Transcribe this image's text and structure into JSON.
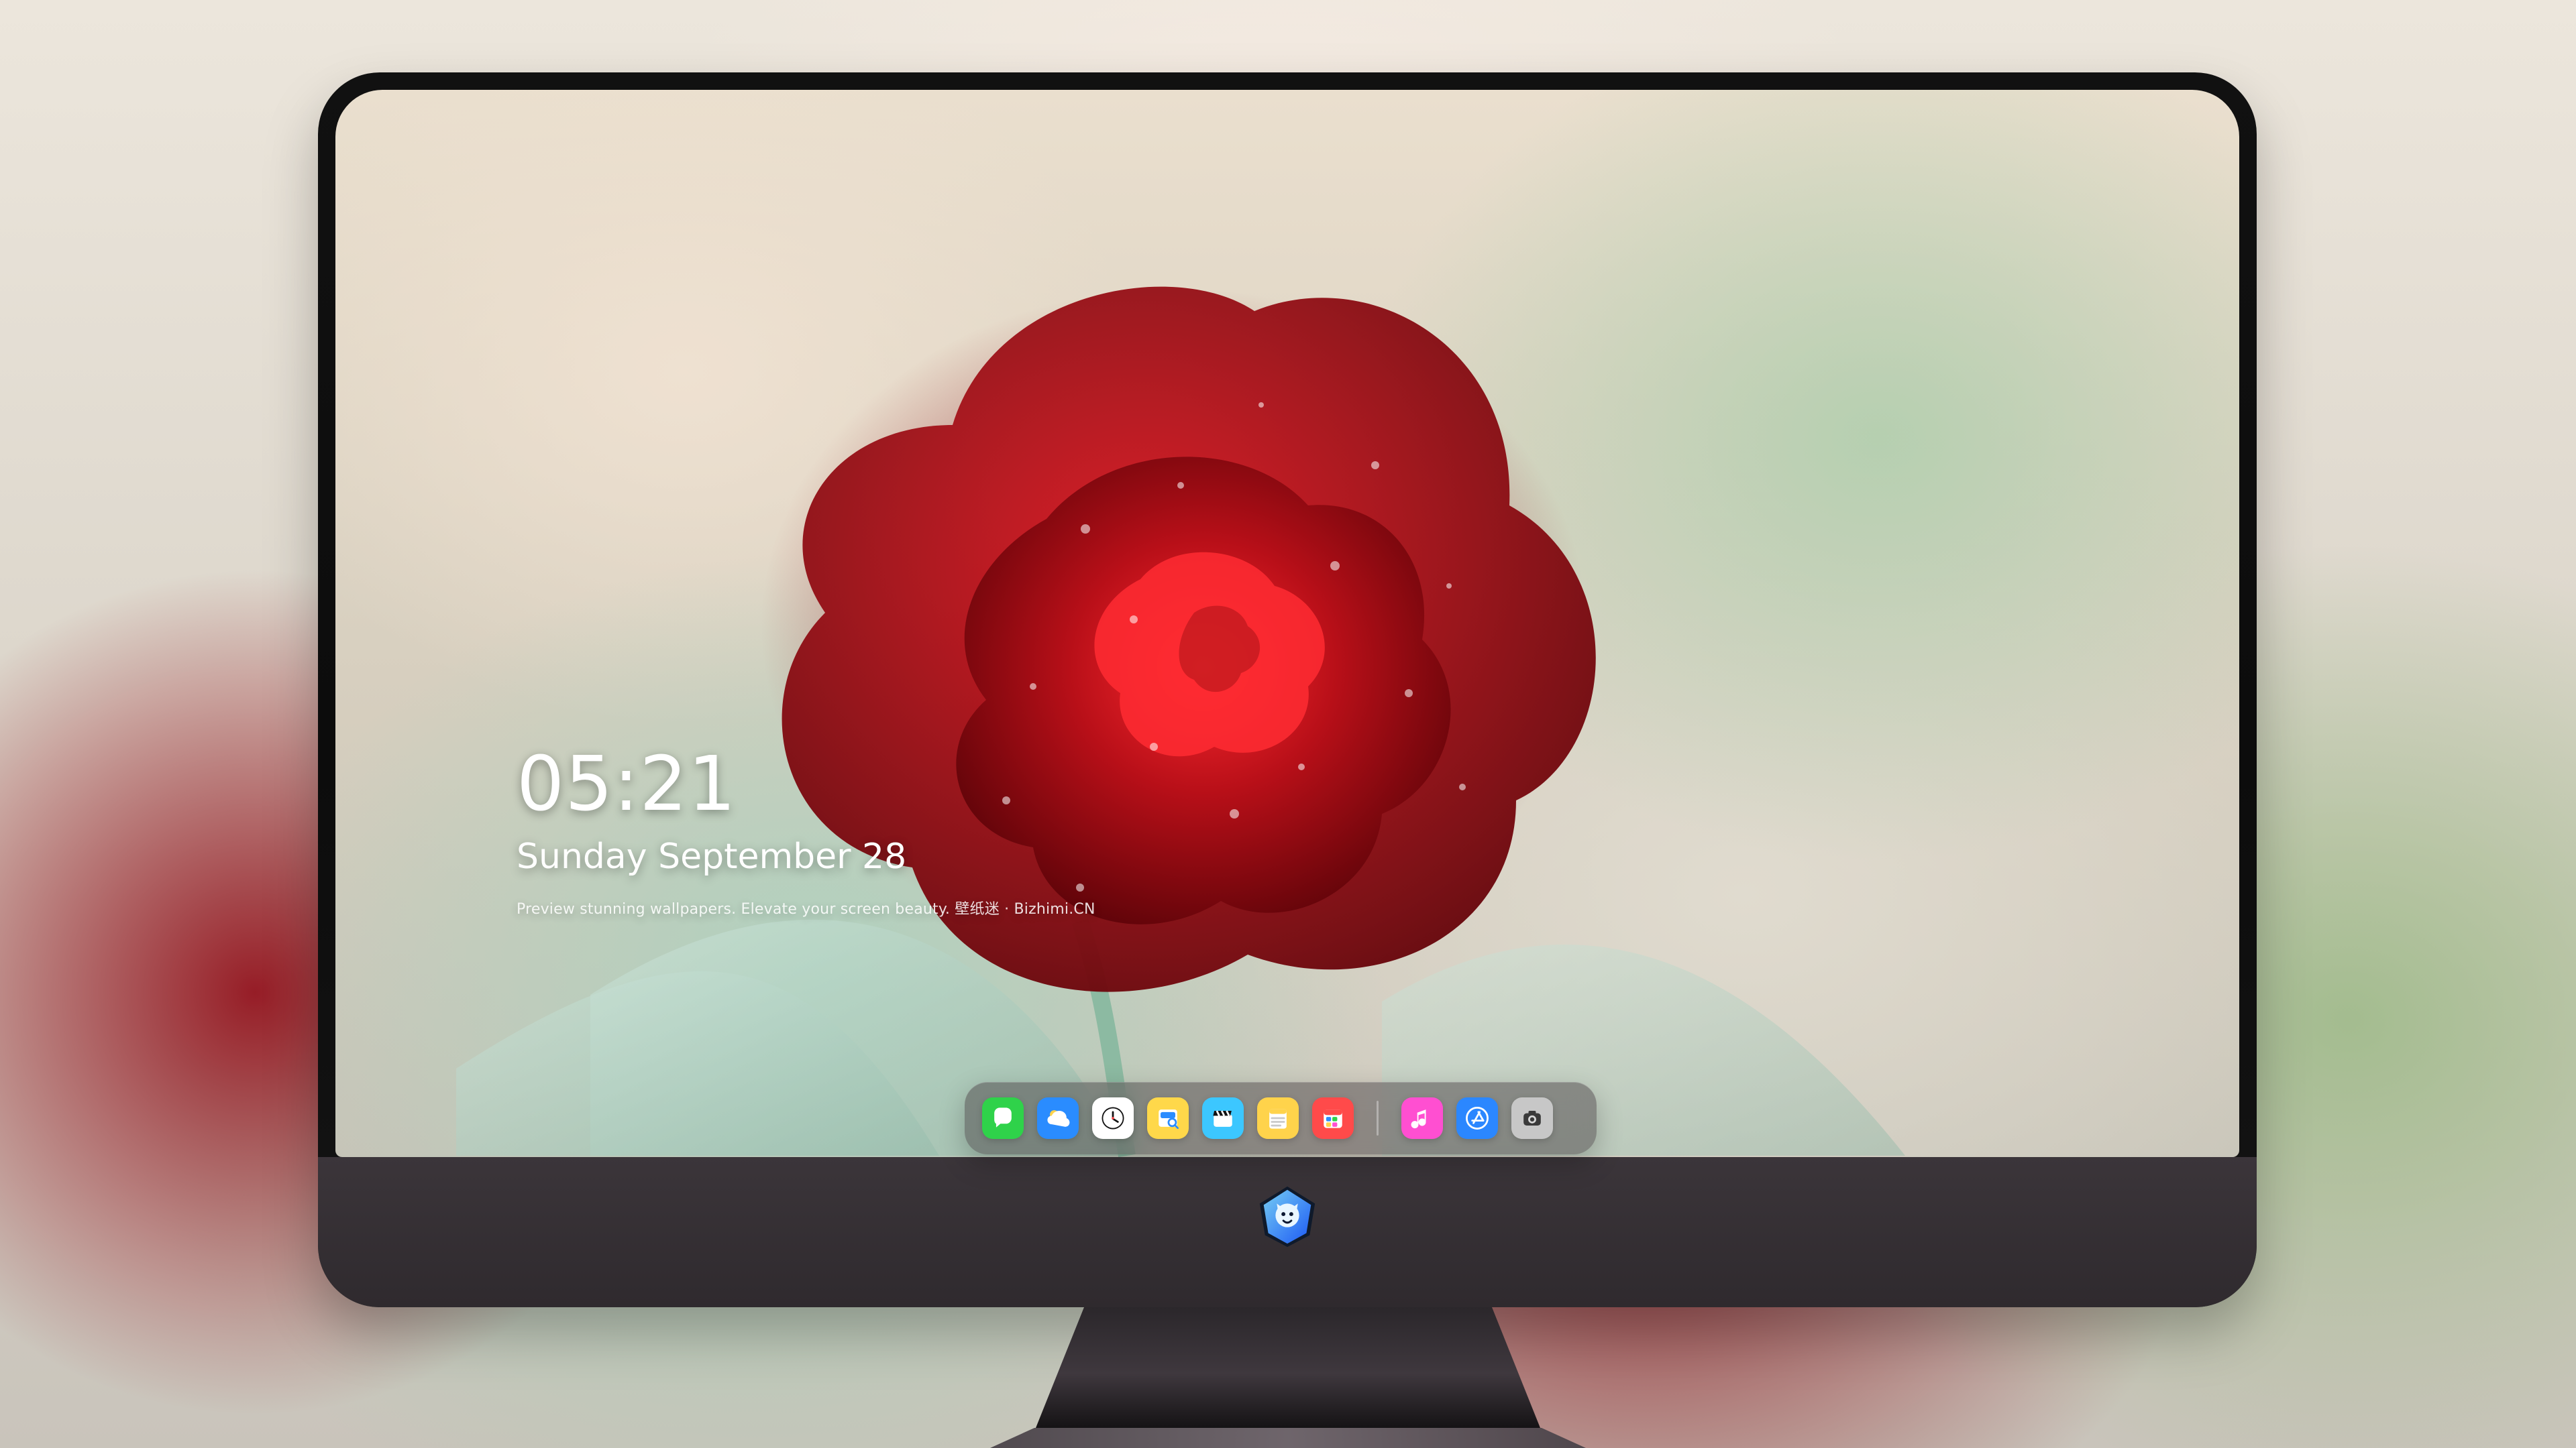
{
  "lock_screen": {
    "time": "05:21",
    "date": "Sunday September  28",
    "tagline": "Preview stunning wallpapers. Elevate your screen beauty. 壁纸迷 · Bizhimi.CN"
  },
  "dock": {
    "apps_left": [
      {
        "name": "Messages",
        "icon": "messages-icon",
        "color": "#2fd24a"
      },
      {
        "name": "Weather",
        "icon": "weather-icon",
        "color": "#2a8cff"
      },
      {
        "name": "Clock",
        "icon": "clock-icon",
        "color": "#ffffff"
      },
      {
        "name": "Preview",
        "icon": "preview-icon",
        "color": "#ffd84a"
      },
      {
        "name": "Video",
        "icon": "clapperboard-icon",
        "color": "#3cc7ff"
      },
      {
        "name": "Notes",
        "icon": "notes-icon",
        "color": "#ffd34b"
      },
      {
        "name": "Calendar",
        "icon": "calendar-icon",
        "color": "#ff4a4a"
      }
    ],
    "apps_right": [
      {
        "name": "Music",
        "icon": "music-icon",
        "color": "#ff4fd1"
      },
      {
        "name": "App Store",
        "icon": "app-store-icon",
        "color": "#2b87ff"
      },
      {
        "name": "Camera",
        "icon": "camera-icon",
        "color": "#c7c7c7"
      }
    ]
  }
}
